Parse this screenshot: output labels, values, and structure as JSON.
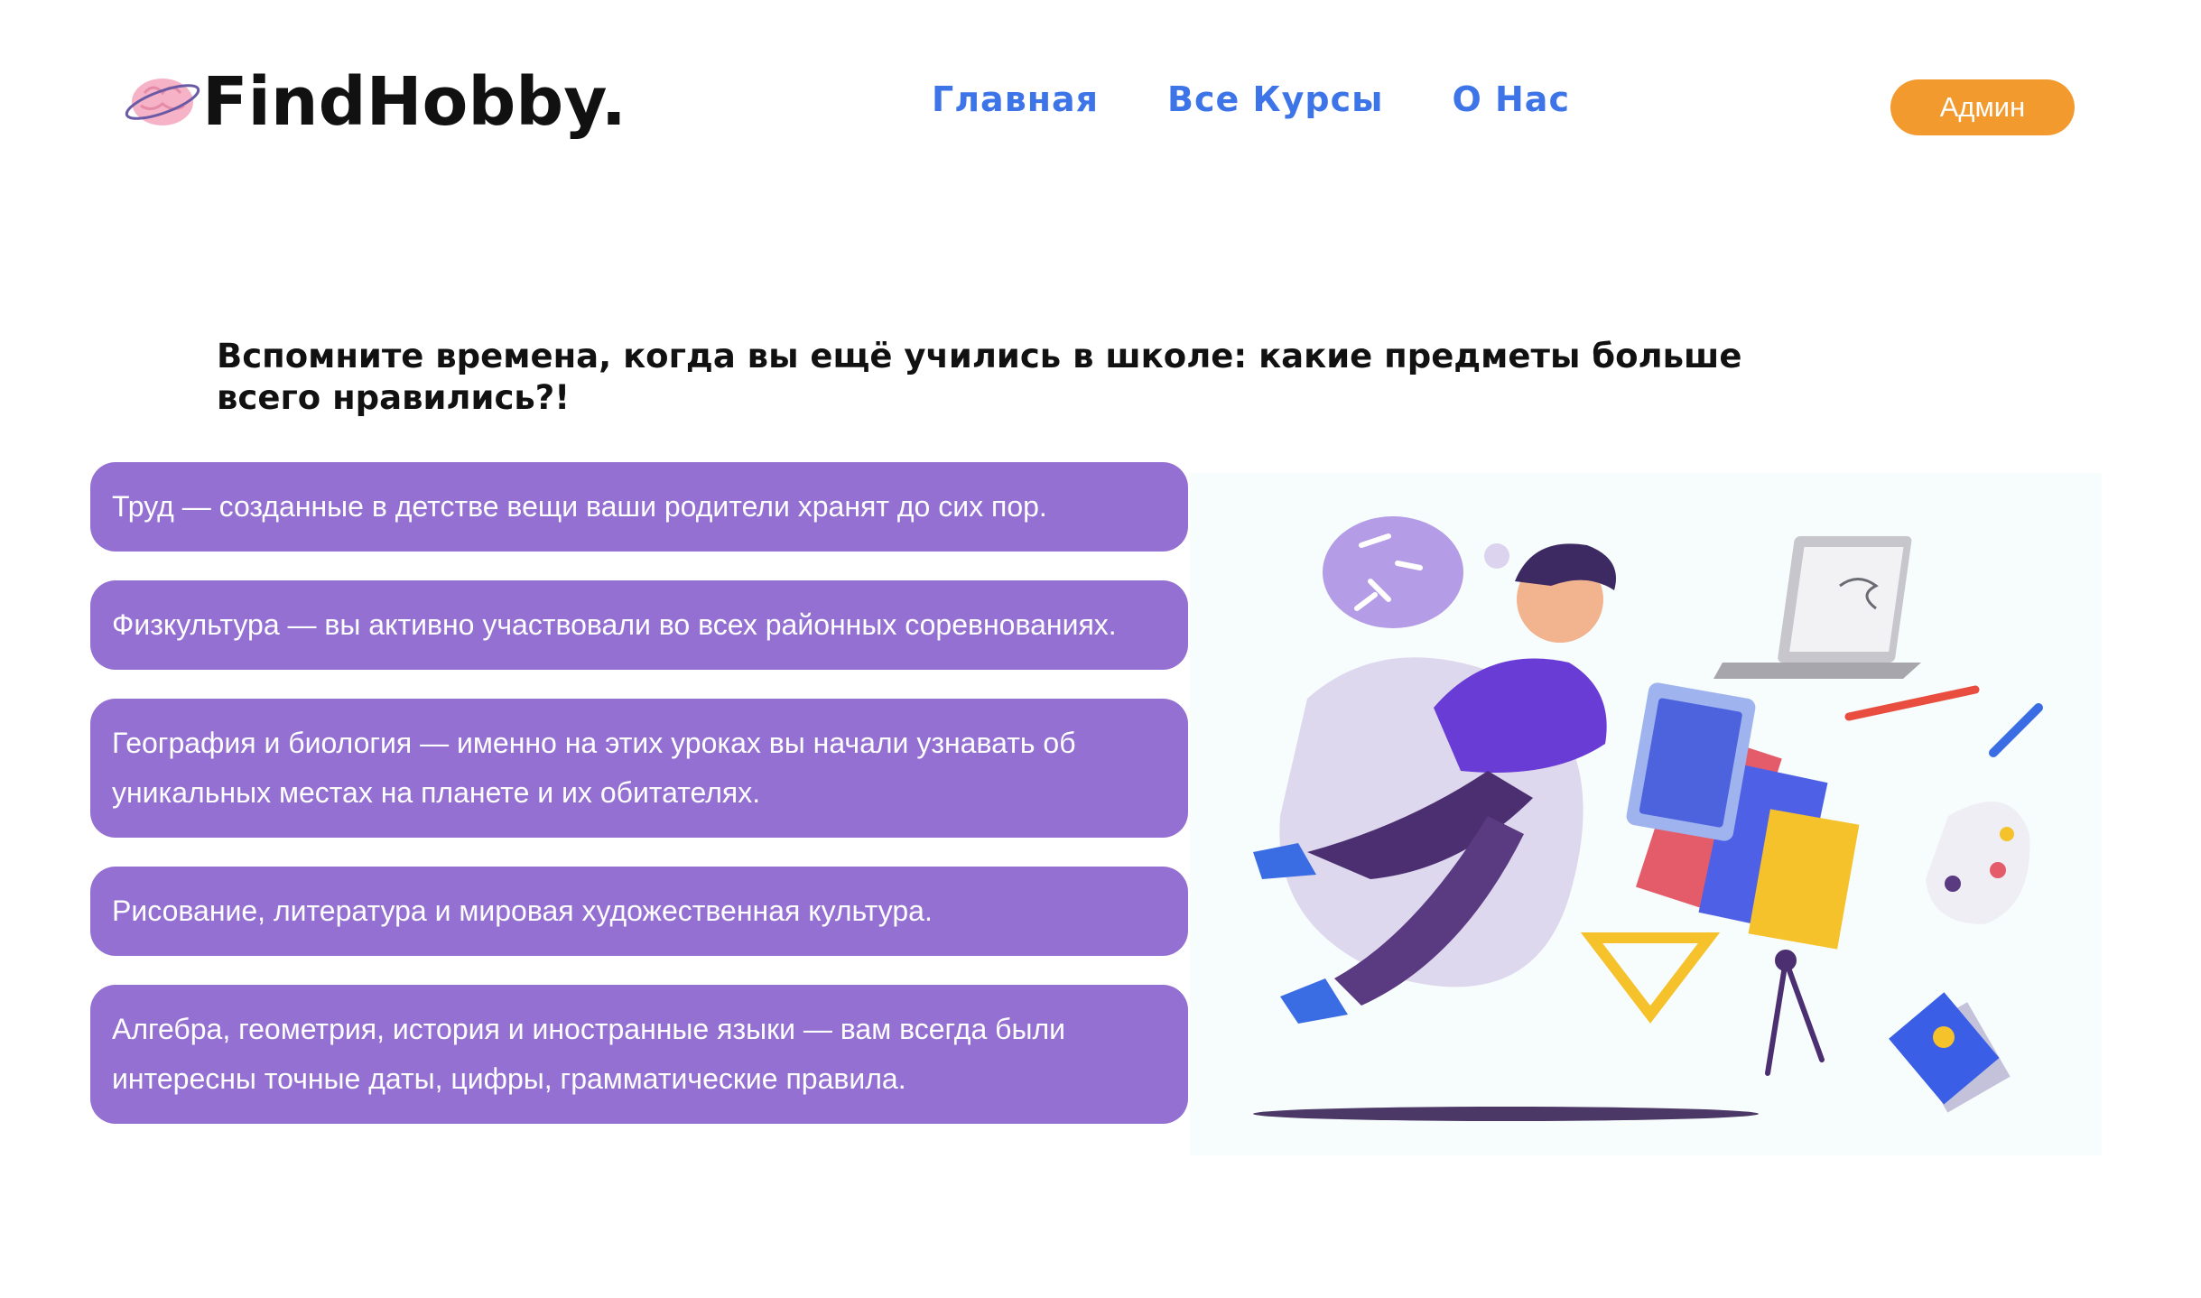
{
  "header": {
    "logo_text": "FindHobby.",
    "nav": [
      "Главная",
      "Все Курсы",
      "О Нас"
    ],
    "admin_label": "Админ"
  },
  "colors": {
    "accent_purple": "#9370d1",
    "nav_blue": "#3d74e8",
    "admin_orange": "#f29a2e"
  },
  "main": {
    "headline": "Вспомните времена, когда вы ещё учились в школе: какие предметы больше всего нравились?!",
    "cards": [
      "Труд — созданные в детстве вещи ваши родители хранят до сих пор.",
      "Физкультура — вы активно участвовали во всех районных соревнованиях.",
      "География и биология — именно на этих уроках вы начали узнавать об уникальных местах на планете и их обитателях.",
      "Рисование, литература и мировая художественная культура.",
      "Алгебра, геометрия, история и иностранные языки — вам всегда были интересны точные даты, цифры, грамматические правила."
    ]
  },
  "illustration": {
    "icon": "student-drawing-illustration"
  }
}
